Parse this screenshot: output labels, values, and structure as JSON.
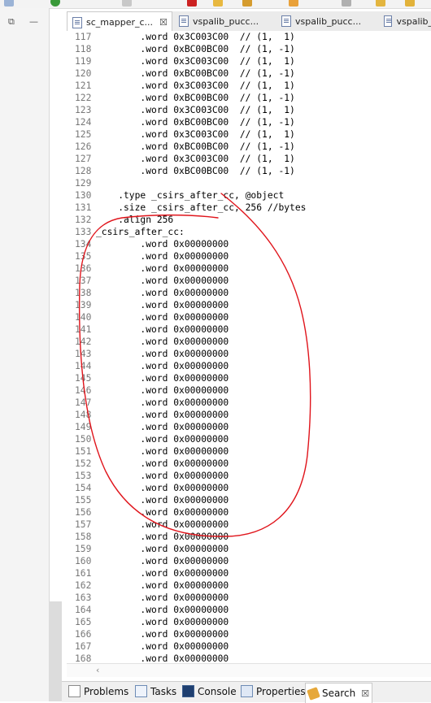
{
  "toolbar": {
    "icons": [
      "back-icon",
      "run-icon",
      "build-icon",
      "folder-icon",
      "edit-icon",
      "search-icon",
      "pin-icon",
      "forward-icon"
    ]
  },
  "editor_tabs": [
    {
      "label": "sc_mapper_c...",
      "active": true,
      "close": "☒"
    },
    {
      "label": "vspalib_pucc...",
      "active": false
    },
    {
      "label": "vspalib_pucc...",
      "active": false
    },
    {
      "label": "vspalib_pu",
      "active": false
    }
  ],
  "lines": [
    {
      "n": "117",
      "code": "        .word 0x3C003C00  // (1,  1)"
    },
    {
      "n": "118",
      "code": "        .word 0xBC00BC00  // (1, -1)"
    },
    {
      "n": "119",
      "code": "        .word 0x3C003C00  // (1,  1)"
    },
    {
      "n": "120",
      "code": "        .word 0xBC00BC00  // (1, -1)"
    },
    {
      "n": "121",
      "code": "        .word 0x3C003C00  // (1,  1)"
    },
    {
      "n": "122",
      "code": "        .word 0xBC00BC00  // (1, -1)"
    },
    {
      "n": "123",
      "code": "        .word 0x3C003C00  // (1,  1)"
    },
    {
      "n": "124",
      "code": "        .word 0xBC00BC00  // (1, -1)"
    },
    {
      "n": "125",
      "code": "        .word 0x3C003C00  // (1,  1)"
    },
    {
      "n": "126",
      "code": "        .word 0xBC00BC00  // (1, -1)"
    },
    {
      "n": "127",
      "code": "        .word 0x3C003C00  // (1,  1)"
    },
    {
      "n": "128",
      "code": "        .word 0xBC00BC00  // (1, -1)"
    },
    {
      "n": "129",
      "code": ""
    },
    {
      "n": "130",
      "code": "    .type _csirs_after_cc, @object"
    },
    {
      "n": "131",
      "code": "    .size _csirs_after_cc, 256 //bytes"
    },
    {
      "n": "132",
      "code": "    .align 256"
    },
    {
      "n": "133",
      "code": "_csirs_after_cc:"
    },
    {
      "n": "134",
      "code": "        .word 0x00000000"
    },
    {
      "n": "135",
      "code": "        .word 0x00000000"
    },
    {
      "n": "136",
      "code": "        .word 0x00000000"
    },
    {
      "n": "137",
      "code": "        .word 0x00000000"
    },
    {
      "n": "138",
      "code": "        .word 0x00000000"
    },
    {
      "n": "139",
      "code": "        .word 0x00000000"
    },
    {
      "n": "140",
      "code": "        .word 0x00000000"
    },
    {
      "n": "141",
      "code": "        .word 0x00000000"
    },
    {
      "n": "142",
      "code": "        .word 0x00000000"
    },
    {
      "n": "143",
      "code": "        .word 0x00000000"
    },
    {
      "n": "144",
      "code": "        .word 0x00000000"
    },
    {
      "n": "145",
      "code": "        .word 0x00000000"
    },
    {
      "n": "146",
      "code": "        .word 0x00000000"
    },
    {
      "n": "147",
      "code": "        .word 0x00000000"
    },
    {
      "n": "148",
      "code": "        .word 0x00000000"
    },
    {
      "n": "149",
      "code": "        .word 0x00000000"
    },
    {
      "n": "150",
      "code": "        .word 0x00000000"
    },
    {
      "n": "151",
      "code": "        .word 0x00000000"
    },
    {
      "n": "152",
      "code": "        .word 0x00000000"
    },
    {
      "n": "153",
      "code": "        .word 0x00000000"
    },
    {
      "n": "154",
      "code": "        .word 0x00000000"
    },
    {
      "n": "155",
      "code": "        .word 0x00000000"
    },
    {
      "n": "156",
      "code": "        .word 0x00000000"
    },
    {
      "n": "157",
      "code": "        .word 0x00000000"
    },
    {
      "n": "158",
      "code": "        .word 0x00000000"
    },
    {
      "n": "159",
      "code": "        .word 0x00000000"
    },
    {
      "n": "160",
      "code": "        .word 0x00000000"
    },
    {
      "n": "161",
      "code": "        .word 0x00000000"
    },
    {
      "n": "162",
      "code": "        .word 0x00000000"
    },
    {
      "n": "163",
      "code": "        .word 0x00000000"
    },
    {
      "n": "164",
      "code": "        .word 0x00000000"
    },
    {
      "n": "165",
      "code": "        .word 0x00000000"
    },
    {
      "n": "166",
      "code": "        .word 0x00000000"
    },
    {
      "n": "167",
      "code": "        .word 0x00000000"
    },
    {
      "n": "168",
      "code": "        .word 0x00000000"
    }
  ],
  "bottom_tabs": [
    {
      "label": "Problems",
      "icon": "problems-icon"
    },
    {
      "label": "Tasks",
      "icon": "tasks-icon"
    },
    {
      "label": "Console",
      "icon": "console-icon"
    },
    {
      "label": "Properties",
      "icon": "properties-icon"
    },
    {
      "label": "Search",
      "icon": "search-icon",
      "active": true,
      "close": "☒"
    }
  ],
  "left_controls": {
    "restore": "⧉",
    "minimize": "—"
  },
  "colors": {
    "annotation": "#e0141b",
    "line_number": "#787878",
    "text": "#000000"
  }
}
